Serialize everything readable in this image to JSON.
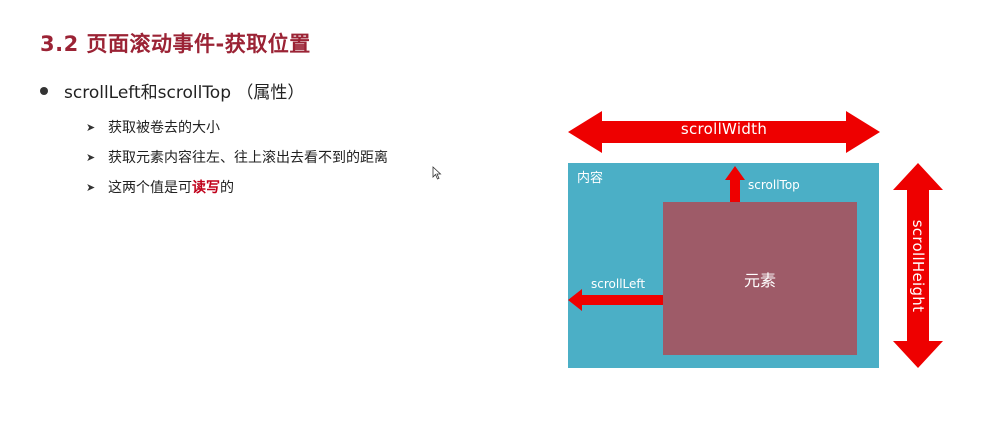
{
  "title": "3.2 页面滚动事件-获取位置",
  "bullet": {
    "main": "scrollLeft和scrollTop （属性）",
    "items": [
      {
        "text": "获取被卷去的大小"
      },
      {
        "text": "获取元素内容往左、往上滚出去看不到的距离"
      },
      {
        "prefix": "这两个值是可",
        "highlight": "读写",
        "suffix": "的"
      }
    ]
  },
  "diagram": {
    "content_label": "内容",
    "element_label": "元素",
    "scroll_top": "scrollTop",
    "scroll_left": "scrollLeft",
    "scroll_width": "scrollWidth",
    "scroll_height": "scrollHeight"
  },
  "colors": {
    "title": "#9b2335",
    "highlight": "#c0001a",
    "content_box": "#4bafc6",
    "element_box": "#9e5b68",
    "arrow": "#ee0000"
  },
  "icons": [
    "mouse-cursor-icon"
  ]
}
